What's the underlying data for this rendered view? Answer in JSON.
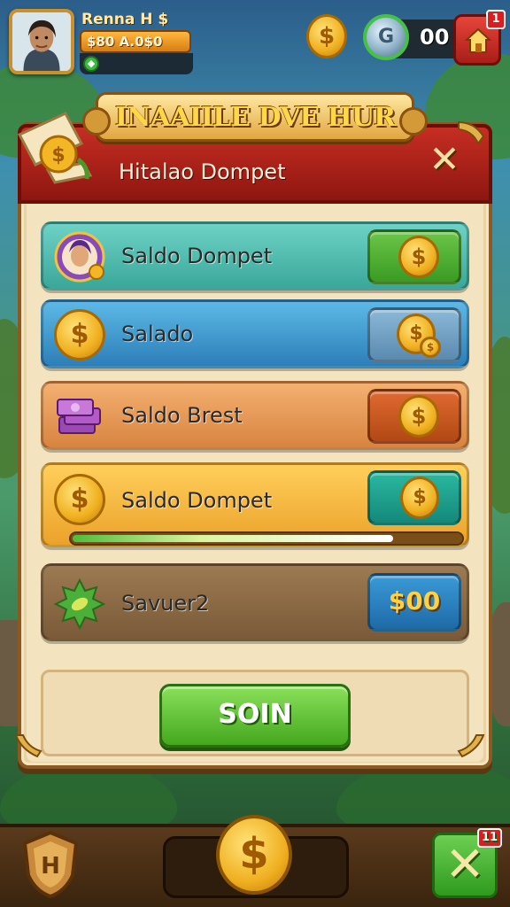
{
  "player": {
    "name": "Renna H $",
    "balance": "$80 A.0$0"
  },
  "hud": {
    "coin_symbol": "$",
    "gem_count": "00",
    "home_badge": "1"
  },
  "title": "INAAIILE DVE HUR",
  "panel": {
    "header_title": "Hitalao Dompet",
    "close_symbol": "✕"
  },
  "rows": [
    {
      "label": "Saldo Dompet",
      "color": "#3aa79a",
      "button_color": "#3f9a2a"
    },
    {
      "label": "Salado",
      "color": "#2c7fb8",
      "button_color": "#6a9ac0"
    },
    {
      "label": "Saldo Brest",
      "color": "#d88440",
      "button_color": "#c2541e"
    },
    {
      "label": "Saldo Dompet",
      "color": "#eba22a",
      "button_color": "#1e9a8a",
      "progress": 0.82
    },
    {
      "label": "Savuer2",
      "color": "#7a5a38",
      "button_color": "#2a7fb8",
      "value": "$00"
    }
  ],
  "join_button": "SOIN",
  "bottom": {
    "shield_letter": "H",
    "coin_symbol": "$",
    "x_symbol": "✕",
    "x_badge": "11"
  },
  "icons": [
    "avatar",
    "coin-icon",
    "gem-icon",
    "home-icon",
    "scroll-icon",
    "close-icon",
    "wallet-avatar-icon",
    "cash-stack-icon",
    "leaf-icon",
    "shield-icon"
  ]
}
